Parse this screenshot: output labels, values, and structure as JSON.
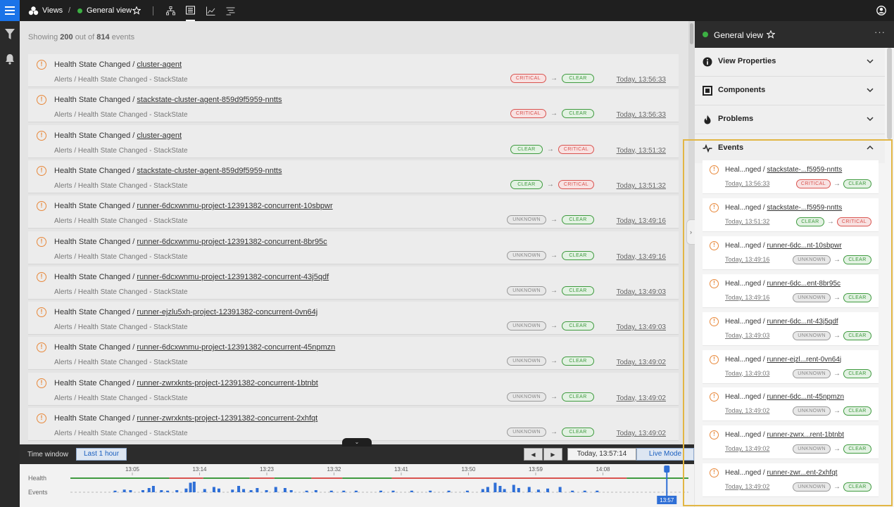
{
  "topbar": {
    "views_label": "Views",
    "separator": "/",
    "view_name": "General view"
  },
  "main": {
    "showing_prefix": "Showing",
    "showing_count": "200",
    "showing_mid": "out of",
    "showing_total": "814",
    "showing_suffix": "events",
    "events": [
      {
        "type": "Health State Changed",
        "component": "cluster-agent",
        "source": "Alerts / Health State Changed - StackState",
        "from": "CRITICAL",
        "to": "CLEAR",
        "time": "Today, 13:56:33"
      },
      {
        "type": "Health State Changed",
        "component": "stackstate-cluster-agent-859d9f5959-nntts",
        "source": "Alerts / Health State Changed - StackState",
        "from": "CRITICAL",
        "to": "CLEAR",
        "time": "Today, 13:56:33"
      },
      {
        "type": "Health State Changed",
        "component": "cluster-agent",
        "source": "Alerts / Health State Changed - StackState",
        "from": "CLEAR",
        "to": "CRITICAL",
        "time": "Today, 13:51:32"
      },
      {
        "type": "Health State Changed",
        "component": "stackstate-cluster-agent-859d9f5959-nntts",
        "source": "Alerts / Health State Changed - StackState",
        "from": "CLEAR",
        "to": "CRITICAL",
        "time": "Today, 13:51:32"
      },
      {
        "type": "Health State Changed",
        "component": "runner-6dcxwnmu-project-12391382-concurrent-10sbpwr",
        "source": "Alerts / Health State Changed - StackState",
        "from": "UNKNOWN",
        "to": "CLEAR",
        "time": "Today, 13:49:16"
      },
      {
        "type": "Health State Changed",
        "component": "runner-6dcxwnmu-project-12391382-concurrent-8br95c",
        "source": "Alerts / Health State Changed - StackState",
        "from": "UNKNOWN",
        "to": "CLEAR",
        "time": "Today, 13:49:16"
      },
      {
        "type": "Health State Changed",
        "component": "runner-6dcxwnmu-project-12391382-concurrent-43j5qdf",
        "source": "Alerts / Health State Changed - StackState",
        "from": "UNKNOWN",
        "to": "CLEAR",
        "time": "Today, 13:49:03"
      },
      {
        "type": "Health State Changed",
        "component": "runner-ejzlu5xh-project-12391382-concurrent-0vn64j",
        "source": "Alerts / Health State Changed - StackState",
        "from": "UNKNOWN",
        "to": "CLEAR",
        "time": "Today, 13:49:03"
      },
      {
        "type": "Health State Changed",
        "component": "runner-6dcxwnmu-project-12391382-concurrent-45npmzn",
        "source": "Alerts / Health State Changed - StackState",
        "from": "UNKNOWN",
        "to": "CLEAR",
        "time": "Today, 13:49:02"
      },
      {
        "type": "Health State Changed",
        "component": "runner-zwrxknts-project-12391382-concurrent-1btnbt",
        "source": "Alerts / Health State Changed - StackState",
        "from": "UNKNOWN",
        "to": "CLEAR",
        "time": "Today, 13:49:02"
      },
      {
        "type": "Health State Changed",
        "component": "runner-zwrxknts-project-12391382-concurrent-2xhfqt",
        "source": "Alerts / Health State Changed - StackState",
        "from": "UNKNOWN",
        "to": "CLEAR",
        "time": "Today, 13:49:02"
      }
    ]
  },
  "timebar": {
    "label": "Time window",
    "window_button": "Last 1 hour",
    "now": "Today, 13:57:14",
    "live_mode": "Live Mode"
  },
  "timeline": {
    "health_label": "Health",
    "events_label": "Events",
    "ticks": [
      "13:05",
      "13:14",
      "13:23",
      "13:32",
      "13:41",
      "13:50",
      "13:59",
      "14:08"
    ],
    "cursor_time": "13:57",
    "health_segments": [
      {
        "from": 0,
        "to": 0.045,
        "state": "CLEAR"
      },
      {
        "from": 0.045,
        "to": 0.16,
        "state": "CLEAR"
      },
      {
        "from": 0.16,
        "to": 0.215,
        "state": "CRITICAL"
      },
      {
        "from": 0.215,
        "to": 0.29,
        "state": "CLEAR"
      },
      {
        "from": 0.29,
        "to": 0.33,
        "state": "CRITICAL"
      },
      {
        "from": 0.33,
        "to": 0.39,
        "state": "CLEAR"
      },
      {
        "from": 0.39,
        "to": 0.44,
        "state": "CRITICAL"
      },
      {
        "from": 0.44,
        "to": 0.52,
        "state": "CLEAR"
      },
      {
        "from": 0.52,
        "to": 0.9,
        "state": "CRITICAL"
      },
      {
        "from": 0.9,
        "to": 1.0,
        "state": "CLEAR"
      }
    ],
    "event_bars": [
      {
        "x": 0.07,
        "h": 0.15
      },
      {
        "x": 0.085,
        "h": 0.25
      },
      {
        "x": 0.095,
        "h": 0.2
      },
      {
        "x": 0.115,
        "h": 0.2
      },
      {
        "x": 0.125,
        "h": 0.4
      },
      {
        "x": 0.132,
        "h": 0.6
      },
      {
        "x": 0.145,
        "h": 0.2
      },
      {
        "x": 0.155,
        "h": 0.15
      },
      {
        "x": 0.17,
        "h": 0.2
      },
      {
        "x": 0.185,
        "h": 0.35
      },
      {
        "x": 0.192,
        "h": 0.9
      },
      {
        "x": 0.198,
        "h": 1.0
      },
      {
        "x": 0.215,
        "h": 0.3
      },
      {
        "x": 0.23,
        "h": 0.5
      },
      {
        "x": 0.238,
        "h": 0.35
      },
      {
        "x": 0.26,
        "h": 0.25
      },
      {
        "x": 0.27,
        "h": 0.6
      },
      {
        "x": 0.278,
        "h": 0.3
      },
      {
        "x": 0.29,
        "h": 0.2
      },
      {
        "x": 0.3,
        "h": 0.4
      },
      {
        "x": 0.315,
        "h": 0.2
      },
      {
        "x": 0.33,
        "h": 0.5
      },
      {
        "x": 0.345,
        "h": 0.4
      },
      {
        "x": 0.355,
        "h": 0.2
      },
      {
        "x": 0.38,
        "h": 0.15
      },
      {
        "x": 0.395,
        "h": 0.2
      },
      {
        "x": 0.42,
        "h": 0.15
      },
      {
        "x": 0.44,
        "h": 0.15
      },
      {
        "x": 0.46,
        "h": 0.15
      },
      {
        "x": 0.5,
        "h": 0.15
      },
      {
        "x": 0.52,
        "h": 0.15
      },
      {
        "x": 0.55,
        "h": 0.15
      },
      {
        "x": 0.58,
        "h": 0.15
      },
      {
        "x": 0.61,
        "h": 0.15
      },
      {
        "x": 0.64,
        "h": 0.15
      },
      {
        "x": 0.665,
        "h": 0.3
      },
      {
        "x": 0.673,
        "h": 0.5
      },
      {
        "x": 0.685,
        "h": 0.9
      },
      {
        "x": 0.693,
        "h": 0.6
      },
      {
        "x": 0.7,
        "h": 0.3
      },
      {
        "x": 0.715,
        "h": 0.7
      },
      {
        "x": 0.723,
        "h": 0.4
      },
      {
        "x": 0.74,
        "h": 0.5
      },
      {
        "x": 0.755,
        "h": 0.25
      },
      {
        "x": 0.77,
        "h": 0.35
      },
      {
        "x": 0.79,
        "h": 0.5
      },
      {
        "x": 0.81,
        "h": 0.15
      },
      {
        "x": 0.83,
        "h": 0.15
      },
      {
        "x": 0.85,
        "h": 0.15
      }
    ],
    "cursor_pos": 0.965
  },
  "rpanel": {
    "title": "General view",
    "sections": [
      "View Properties",
      "Components",
      "Problems",
      "Events"
    ],
    "events": [
      {
        "type": "Heal...nged",
        "component": "stackstate-...f5959-nntts",
        "time": "Today, 13:56:33",
        "from": "CRITICAL",
        "to": "CLEAR"
      },
      {
        "type": "Heal...nged",
        "component": "stackstate-...f5959-nntts",
        "time": "Today, 13:51:32",
        "from": "CLEAR",
        "to": "CRITICAL"
      },
      {
        "type": "Heal...nged",
        "component": "runner-6dc...nt-10sbpwr",
        "time": "Today, 13:49:16",
        "from": "UNKNOWN",
        "to": "CLEAR"
      },
      {
        "type": "Heal...nged",
        "component": "runner-6dc...ent-8br95c",
        "time": "Today, 13:49:16",
        "from": "UNKNOWN",
        "to": "CLEAR"
      },
      {
        "type": "Heal...nged",
        "component": "runner-6dc...nt-43j5qdf",
        "time": "Today, 13:49:03",
        "from": "UNKNOWN",
        "to": "CLEAR"
      },
      {
        "type": "Heal...nged",
        "component": "runner-ejzl...rent-0vn64j",
        "time": "Today, 13:49:03",
        "from": "UNKNOWN",
        "to": "CLEAR"
      },
      {
        "type": "Heal...nged",
        "component": "runner-6dc...nt-45npmzn",
        "time": "Today, 13:49:02",
        "from": "UNKNOWN",
        "to": "CLEAR"
      },
      {
        "type": "Heal...nged",
        "component": "runner-zwrx...rent-1btnbt",
        "time": "Today, 13:49:02",
        "from": "UNKNOWN",
        "to": "CLEAR"
      },
      {
        "type": "Heal...nged",
        "component": "runner-zwr...ent-2xhfqt",
        "time": "Today, 13:49:02",
        "from": "UNKNOWN",
        "to": "CLEAR"
      }
    ]
  },
  "colors": {
    "accent": "#1a73e8",
    "critical": "#d9534f",
    "clear": "#3f9a3f",
    "unknown": "#999999",
    "warning": "#e8883a",
    "highlight": "#e2b644",
    "bars": "#2f6fd6",
    "status_dot": "#3cb043"
  }
}
